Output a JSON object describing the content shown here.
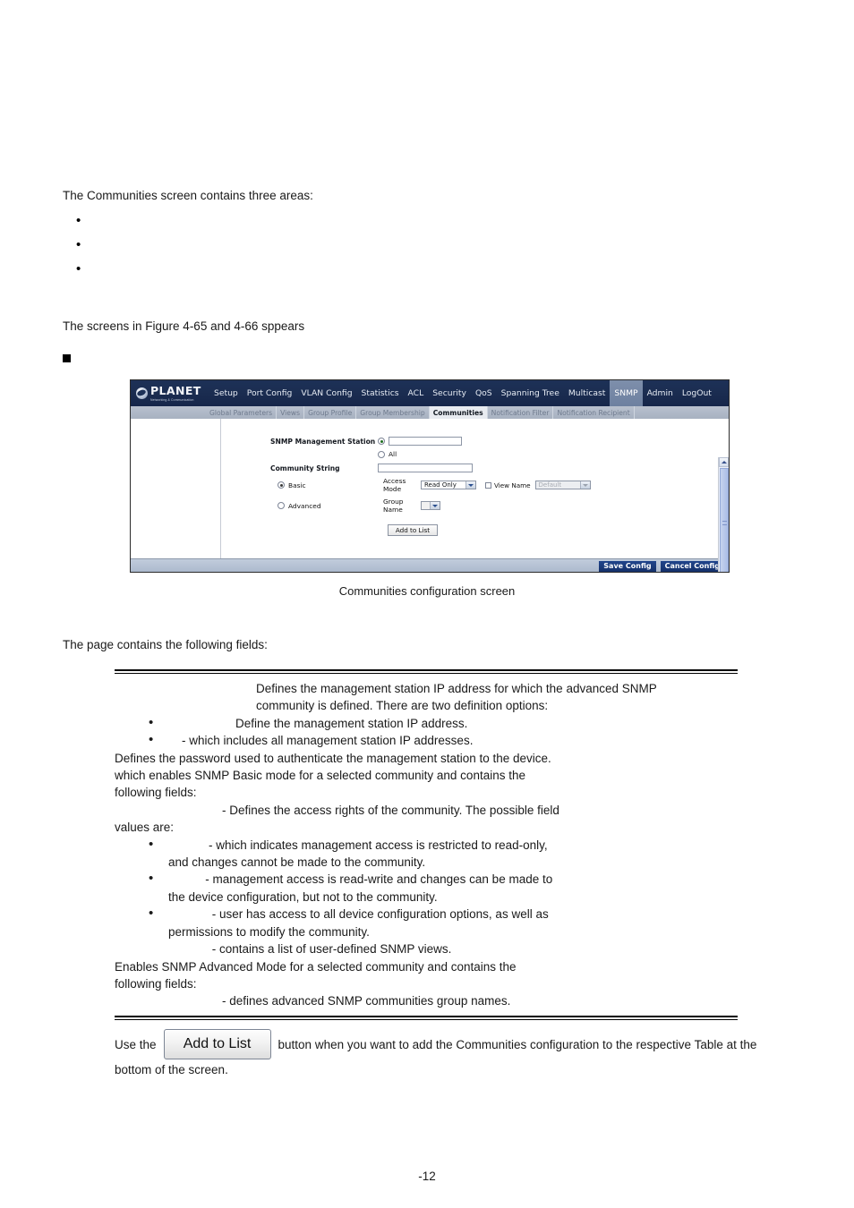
{
  "document": {
    "intro_line": "The Communities screen contains three areas:",
    "bullets": [
      "",
      "",
      ""
    ],
    "screens_line": "The screens in Figure 4-65 and 4-66 sppears",
    "figure_caption": "Communities configuration screen",
    "fields_intro": "The page contains the following fields:",
    "page_number": "-12"
  },
  "device_screen": {
    "logo": {
      "name": "PLANET",
      "tagline": "Networking & Communication"
    },
    "nav_items": [
      {
        "label": "Setup",
        "active": false
      },
      {
        "label": "Port Config",
        "active": false
      },
      {
        "label": "VLAN Config",
        "active": false
      },
      {
        "label": "Statistics",
        "active": false
      },
      {
        "label": "ACL",
        "active": false
      },
      {
        "label": "Security",
        "active": false
      },
      {
        "label": "QoS",
        "active": false
      },
      {
        "label": "Spanning Tree",
        "active": false
      },
      {
        "label": "Multicast",
        "active": false
      },
      {
        "label": "SNMP",
        "active": true
      },
      {
        "label": "Admin",
        "active": false
      },
      {
        "label": "LogOut",
        "active": false
      }
    ],
    "sub_nav_items": [
      {
        "label": "Global Parameters",
        "active": false
      },
      {
        "label": "Views",
        "active": false
      },
      {
        "label": "Group Profile",
        "active": false
      },
      {
        "label": "Group Membership",
        "active": false
      },
      {
        "label": "Communities",
        "active": true
      },
      {
        "label": "Notification Filter",
        "active": false
      },
      {
        "label": "Notification Recipient",
        "active": false
      }
    ],
    "form": {
      "snmp_management_station_label": "SNMP Management Station",
      "snmp_station_ip_value": "",
      "snmp_station_all_label": "All",
      "community_string_label": "Community String",
      "community_string_value": "",
      "basic_label": "Basic",
      "advanced_label": "Advanced",
      "access_mode_label": "Access Mode",
      "access_mode_value": "Read Only",
      "group_name_label": "Group Name",
      "group_name_value": "",
      "view_name_label": "View Name",
      "view_name_value": "Default",
      "add_to_list_label": "Add to List"
    },
    "footer": {
      "save_label": "Save Config",
      "cancel_label": "Cancel Config"
    },
    "colors": {
      "nav_navy": "#1b2d51",
      "nav_active": "#72849f",
      "sub_nav": "#aeb8c6",
      "button_blue": "#1a3a7c"
    }
  },
  "field_descriptions": {
    "l1": "Defines the management station IP address for which the advanced SNMP",
    "l2": "community is defined. There are two definition options:",
    "b1": "                    Define the management station IP address.",
    "b2": "    - which includes all management station IP addresses.",
    "l3": "Defines the password used to authenticate the management station to the device.",
    "l4": "which enables SNMP Basic mode for a selected community and contains the",
    "l5": "following fields:",
    "l6": "                - Defines the access rights of the community. The possible field",
    "l7": "values are:",
    "b3": "            - which indicates management access is restricted to read-only,",
    "b3c": "and changes cannot be made to the community.",
    "b4": "           - management access is read-write and changes can be made to",
    "b4c": "the device configuration, but not to the community.",
    "b5": "             - user has access to all device configuration options, as well as",
    "b5c": "permissions to modify the community.",
    "l8": "             - contains a list of user-defined SNMP views.",
    "l9": "Enables SNMP Advanced Mode for a selected community and contains the",
    "l10": "following fields:",
    "l11": "                - defines advanced SNMP communities group names."
  },
  "usage": {
    "pre": "Use the",
    "button_label": "Add to List",
    "post": "button when you want to add the Communities configuration to the respective Table at the",
    "tail": "bottom of the screen."
  }
}
